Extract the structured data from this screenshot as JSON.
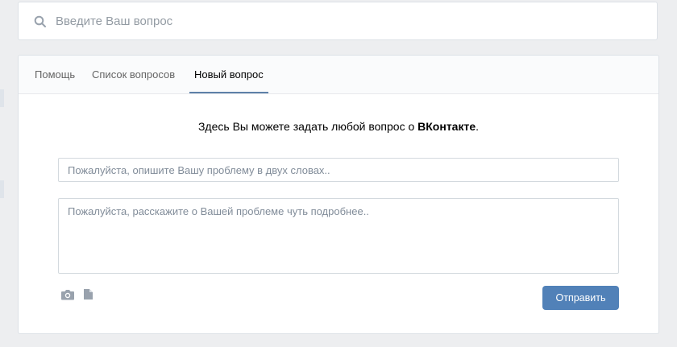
{
  "search": {
    "placeholder": "Введите Ваш вопрос",
    "icon": "search-icon"
  },
  "tabs": [
    {
      "label": "Помощь",
      "active": false
    },
    {
      "label": "Список вопросов",
      "active": false
    },
    {
      "label": "Новый вопрос",
      "active": true
    }
  ],
  "intro": {
    "text_before": "Здесь Вы можете задать любой вопрос о ",
    "brand": "ВКонтакте",
    "text_after": "."
  },
  "form": {
    "title_placeholder": "Пожалуйста, опишите Вашу проблему в двух словах..",
    "title_value": "",
    "body_placeholder": "Пожалуйста, расскажите о Вашей проблеме чуть подробнее..",
    "body_value": "",
    "attachments": [
      {
        "icon": "camera-icon"
      },
      {
        "icon": "document-icon"
      }
    ],
    "submit_label": "Отправить"
  },
  "colors": {
    "background": "#edeef0",
    "accent": "#5181b8",
    "active_tab_underline": "#5e81a8",
    "icon_gray": "#99a2ad"
  }
}
